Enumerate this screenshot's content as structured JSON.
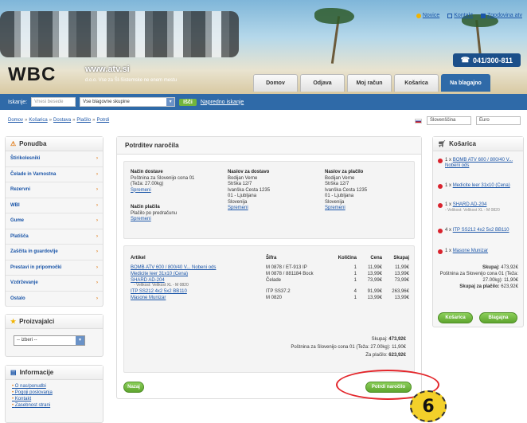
{
  "header": {
    "logo": "WBC",
    "url": "www.atv.si",
    "tagline": "d.o.o. Vse za ŠI-Sistemske ne enem mestu",
    "top_links": [
      "Novice",
      "Kontakt",
      "Zgodovina atv"
    ],
    "phone": "041/300-811",
    "nav": [
      "Domov",
      "Odjava",
      "Moj račun",
      "Košarica",
      "Na blagajno"
    ]
  },
  "search": {
    "label": "Iskanje:",
    "input_placeholder": "Vnesi besede",
    "category": "Vse blagovne skupine",
    "go": "Išči",
    "advanced": "Napredno iskanje"
  },
  "breadcrumb": [
    "Domov",
    "Košarica",
    "Dostava",
    "Plačilo",
    "Potrdi"
  ],
  "locale": {
    "language": "Slovenščina",
    "currency": "Euro"
  },
  "sidebar": {
    "categories_title": "Ponudba",
    "categories": [
      "Štirikolesniki",
      "Čelade in Varnostna",
      "Rezervni",
      "WBI",
      "Gume",
      "Platišča",
      "Zaščita in guardovlje",
      "Prestavi in pripomočki",
      "Vzdrževanje",
      "Ostalo"
    ],
    "manufacturers_title": "Proizvajalci",
    "manufacturer_select": "-- izberi --",
    "info_title": "Informacije",
    "info_links": [
      "O nas/ponudbi",
      "Pogoji poslovanja",
      "Kontakt",
      "Zasebnost strani"
    ]
  },
  "order": {
    "title": "Potrditev naročila",
    "delivery_method": {
      "heading": "Način dostave",
      "lines": [
        "Poštnina za Slovenijo cona 01",
        "(Teža: 27.00kg)"
      ],
      "edit": "Spremeni"
    },
    "payment_method": {
      "heading": "Način plačila",
      "lines": [
        "Plačilo po predračunu"
      ],
      "edit": "Spremeni"
    },
    "shipping_address": {
      "heading": "Naslov za dostavo",
      "lines": [
        "Bodijan Verne",
        "Strška 12/7",
        "Ivanška Cesta 1235",
        "01 - Ljubljana",
        "Slovenija"
      ],
      "edit": "Spremeni"
    },
    "billing_address": {
      "heading": "Naslov za plačilo",
      "lines": [
        "Bodijan Verne",
        "Strška 12/7",
        "Ivanška Cesta 1235",
        "01 - Ljubljana",
        "Slovenija"
      ],
      "edit": "Spremeni"
    },
    "columns": {
      "article": "Artikel",
      "code": "Šifra",
      "qty": "Količina",
      "price": "Cena",
      "total": "Skupaj"
    },
    "items": [
      {
        "name": "BOMB ATV 600 / 800/40 V... Nobeni ods",
        "sub": "",
        "code": "M 0878 / ET-913 IP",
        "qty": "1",
        "price": "11,99€",
        "total": "11,99€"
      },
      {
        "name": "Medicite leer 31x10 (Cena)",
        "sub": "",
        "code": "M 0878 / 881184 Bock",
        "qty": "1",
        "price": "13,99€",
        "total": "13,99€"
      },
      {
        "name": "SHARD AD-204",
        "sub": "- Velikost: Velikost XL - M 0820",
        "code": "Čelade",
        "qty": "1",
        "price": "73,99€",
        "total": "73,99€"
      },
      {
        "name": "ITP SS212 4x2 5x2 BB110",
        "sub": "",
        "code": "ITP SS37.2",
        "qty": "4",
        "price": "91,99€",
        "total": "263,96€"
      },
      {
        "name": "Masone Munizar",
        "sub": "",
        "code": "M 0820",
        "qty": "1",
        "price": "13,99€",
        "total": "13,99€"
      }
    ],
    "totals": [
      {
        "label": "Skupaj:",
        "value": "473,92€",
        "bold": false
      },
      {
        "label": "Poštnina za Slovenijo cona 01 (Teža: 27.00kg):",
        "value": "11,90€",
        "bold": false
      },
      {
        "label": "Za plačilo:",
        "value": "623,92€",
        "bold": true
      }
    ],
    "back_button": "Nazaj",
    "confirm_button": "Potrdi naročilo"
  },
  "cart": {
    "title": "Košarica",
    "items": [
      {
        "qty": "1 x",
        "name": "BOMB ATV 600 / 800/40 V... Nobeni ods",
        "sub": ""
      },
      {
        "qty": "1 x",
        "name": "Medicite leer 31x10 (Cena)",
        "sub": ""
      },
      {
        "qty": "1 x",
        "name": "SHARD AD-204",
        "sub": "- Velikost: Velikost XL - M 0820"
      },
      {
        "qty": "4 x",
        "name": "ITP SS212 4x2 5x2 BB110",
        "sub": ""
      },
      {
        "qty": "1 x",
        "name": "Masone Munizar",
        "sub": ""
      }
    ],
    "summary": [
      {
        "label": "Skupaj:",
        "value": "473,92€",
        "bold": true
      },
      {
        "label": "Poštnina za Slovenijo cona 01 (Teža: 27.00kg):",
        "value": "11,90€",
        "bold": false
      },
      {
        "label": "Skupaj za plačilo:",
        "value": "623,92€",
        "bold": true
      }
    ],
    "cart_button": "Košarica",
    "checkout_button": "Blagajna"
  },
  "step_badge": "6",
  "colors": {
    "brand_blue": "#2f6aa8",
    "link": "#1a55a8",
    "green": "#5ea52e",
    "highlight": "#e3262b",
    "badge": "#f3d02a"
  }
}
